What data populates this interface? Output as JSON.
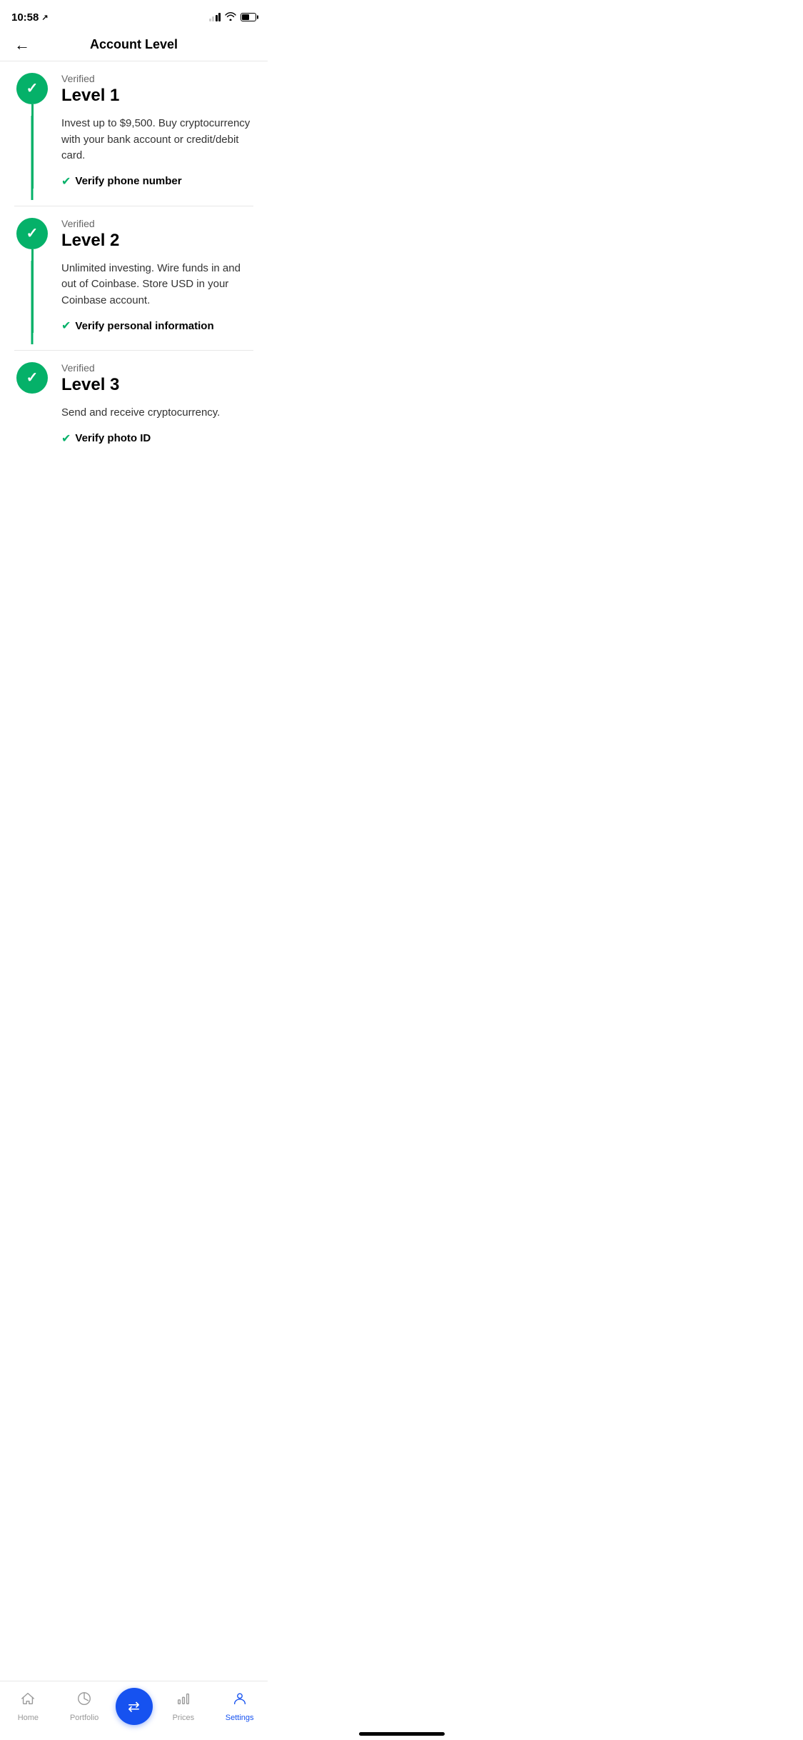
{
  "statusBar": {
    "time": "10:58",
    "locationIcon": "↗"
  },
  "header": {
    "backLabel": "←",
    "title": "Account Level"
  },
  "levels": [
    {
      "id": "level1",
      "statusLabel": "Verified",
      "title": "Level 1",
      "description": "Invest up to $9,500. Buy cryptocurrency with your bank account or credit/debit card.",
      "verifyLabel": "Verify phone number",
      "verified": true
    },
    {
      "id": "level2",
      "statusLabel": "Verified",
      "title": "Level 2",
      "description": "Unlimited investing. Wire funds in and out of Coinbase. Store USD in your Coinbase account.",
      "verifyLabel": "Verify personal information",
      "verified": true
    },
    {
      "id": "level3",
      "statusLabel": "Verified",
      "title": "Level 3",
      "description": "Send and receive cryptocurrency.",
      "verifyLabel": "Verify photo ID",
      "verified": true
    }
  ],
  "tabBar": {
    "items": [
      {
        "label": "Home",
        "icon": "🏠",
        "active": false
      },
      {
        "label": "Portfolio",
        "icon": "◑",
        "active": false
      },
      {
        "label": "",
        "icon": "⇄",
        "active": false,
        "isTrade": true
      },
      {
        "label": "Prices",
        "icon": "📊",
        "active": false
      },
      {
        "label": "Settings",
        "icon": "👤",
        "active": true
      }
    ]
  },
  "colors": {
    "green": "#05b169",
    "blue": "#1652f0"
  }
}
